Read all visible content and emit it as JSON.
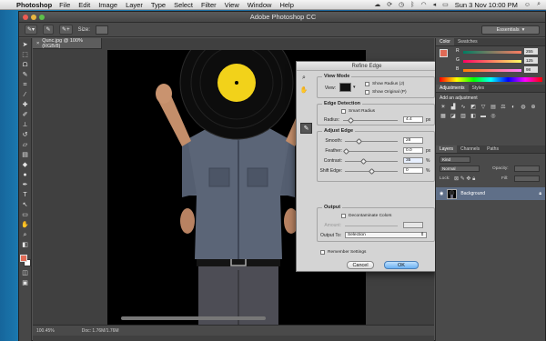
{
  "menubar": {
    "app_name": "Photoshop",
    "menus": [
      "File",
      "Edit",
      "Image",
      "Layer",
      "Type",
      "Select",
      "Filter",
      "View",
      "Window",
      "Help"
    ],
    "clock": "Sun 3 Nov  10:00 PM",
    "icons": [
      "apple-icon",
      "cloud-icon",
      "sync-icon",
      "clock-icon",
      "bluetooth-icon",
      "wifi-icon",
      "volume-icon",
      "battery-icon",
      "user-icon"
    ]
  },
  "window": {
    "title": "Adobe Photoshop CC"
  },
  "optionsbar": {
    "size_label": "Size:",
    "size_value": "",
    "workspace": "Essentials"
  },
  "document": {
    "tab_label": "Qunc.jpg @ 100% (RGB/8)",
    "zoom": "100.45%",
    "doc_info": "Doc: 1.76M/1.76M"
  },
  "refine_edge": {
    "title": "Refine Edge",
    "view_mode": {
      "label": "View Mode",
      "view_label": "View:",
      "show_radius": "Show Radius (J)",
      "show_original": "Show Original (P)"
    },
    "edge_detection": {
      "label": "Edge Detection",
      "smart_radius": "Smart Radius",
      "radius_label": "Radius:",
      "radius_value": "4.4",
      "radius_unit": "px"
    },
    "adjust_edge": {
      "label": "Adjust Edge",
      "smooth_label": "Smooth:",
      "smooth_value": "28",
      "feather_label": "Feather:",
      "feather_value": "0.0",
      "feather_unit": "px",
      "contrast_label": "Contrast:",
      "contrast_value": "35",
      "contrast_unit": "%",
      "shift_label": "Shift Edge:",
      "shift_value": "0",
      "shift_unit": "%"
    },
    "output": {
      "label": "Output",
      "decontaminate": "Decontaminate Colors",
      "amount_label": "Amount:",
      "output_to_label": "Output To:",
      "output_to_value": "Selection"
    },
    "remember": "Remember Settings",
    "cancel": "Cancel",
    "ok": "OK"
  },
  "color_panel": {
    "tabs": [
      "Color",
      "Swatches"
    ],
    "r_label": "R",
    "r_value": "255",
    "g_label": "G",
    "g_value": "125",
    "b_label": "B",
    "b_value": "98"
  },
  "adjustments_panel": {
    "tabs": [
      "Adjustments",
      "Styles"
    ],
    "title": "Add an adjustment"
  },
  "layers_panel": {
    "tabs": [
      "Layers",
      "Channels",
      "Paths"
    ],
    "kind_label": "Kind",
    "blend_mode": "Normal",
    "opacity_label": "Opacity:",
    "lock_label": "Lock:",
    "fill_label": "Fill:",
    "layer_name": "Background"
  }
}
